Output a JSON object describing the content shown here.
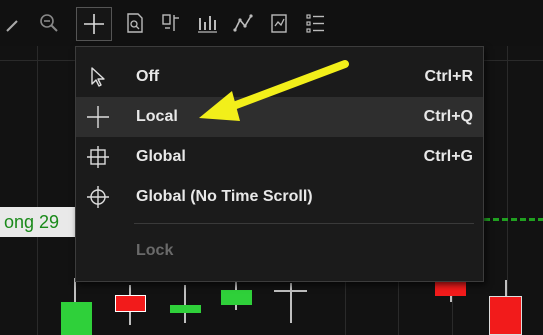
{
  "toolbar": {
    "buttons": [
      {
        "name": "cursor-icon"
      },
      {
        "name": "zoom-out-icon"
      },
      {
        "name": "crosshair-icon",
        "active": true
      },
      {
        "name": "document-search-icon"
      },
      {
        "name": "compare-icon"
      },
      {
        "name": "bar-chart-icon"
      },
      {
        "name": "line-chart-icon"
      },
      {
        "name": "report-icon"
      },
      {
        "name": "list-icon"
      }
    ]
  },
  "chart": {
    "price_label": "ong 29"
  },
  "menu": {
    "items": [
      {
        "label": "Off",
        "shortcut": "Ctrl+R",
        "icon": "cursor-arrow-icon"
      },
      {
        "label": "Local",
        "shortcut": "Ctrl+Q",
        "icon": "crosshair-icon"
      },
      {
        "label": "Global",
        "shortcut": "Ctrl+G",
        "icon": "global-crosshair-icon"
      },
      {
        "label": "Global (No Time Scroll)",
        "shortcut": "",
        "icon": "target-crosshair-icon"
      },
      {
        "label": "Lock",
        "shortcut": "",
        "icon": "",
        "disabled": true
      }
    ]
  },
  "colors": {
    "accent_arrow": "#f2ef1a",
    "bull": "#2fd03a",
    "bear": "#f21b1b"
  }
}
